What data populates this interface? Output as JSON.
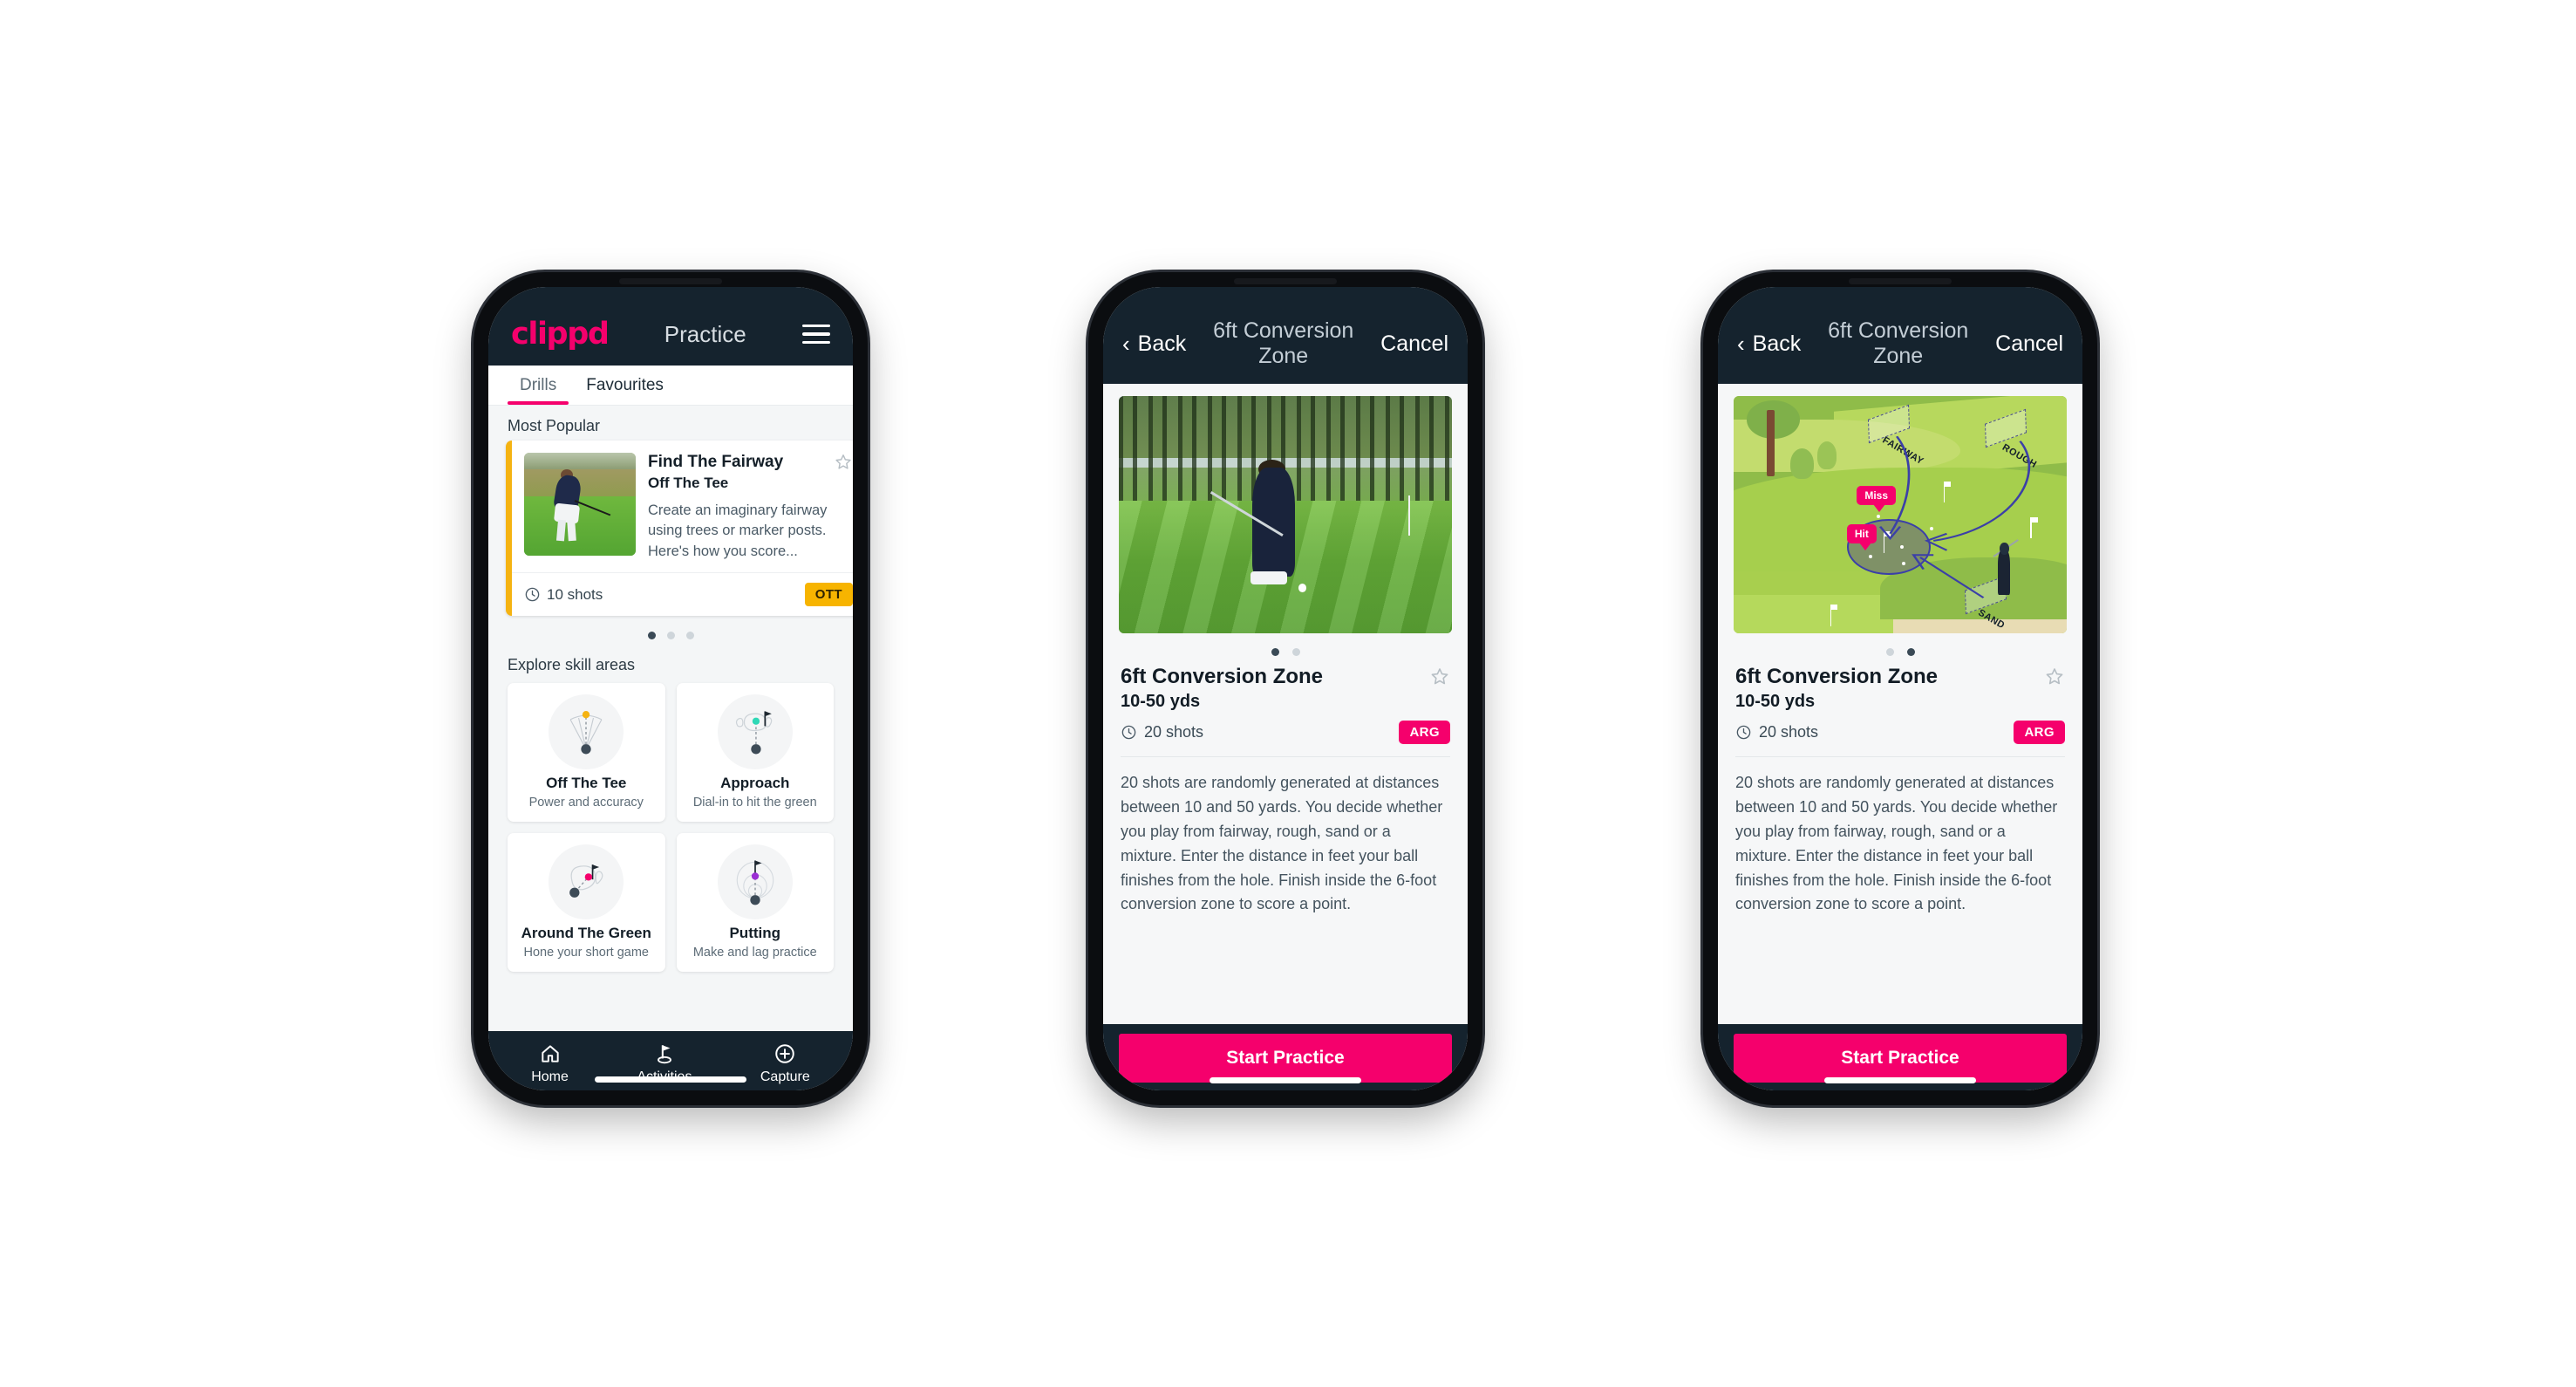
{
  "app": {
    "logo": "clippd",
    "brand_pink": "#f5006c",
    "dark_navy": "#15232e"
  },
  "phone1": {
    "header": {
      "title": "Practice",
      "menu_icon": "hamburger-icon"
    },
    "tabs": [
      {
        "label": "Drills",
        "active": true
      },
      {
        "label": "Favourites",
        "active": false
      }
    ],
    "most_popular": {
      "section_label": "Most Popular",
      "card": {
        "title": "Find The Fairway",
        "subtitle": "Off The Tee",
        "description": "Create an imaginary fairway using trees or marker posts. Here's how you score...",
        "shots": "10 shots",
        "badge": "OTT",
        "badge_color": "#f7b400",
        "accent_color": "#f5b312",
        "star_icon": "star-outline-icon",
        "clock_icon": "clock-icon"
      },
      "peek_accent_color": "#3ddbc0",
      "pagination": {
        "count": 3,
        "active_index": 0
      }
    },
    "explore": {
      "section_label": "Explore skill areas",
      "skills": [
        {
          "name": "Off The Tee",
          "desc": "Power and accuracy",
          "icon": "tee-fan-icon",
          "accent": "#f5b312"
        },
        {
          "name": "Approach",
          "desc": "Dial-in to hit the green",
          "icon": "approach-green-icon",
          "accent": "#3ddbc0"
        },
        {
          "name": "Around The Green",
          "desc": "Hone your short game",
          "icon": "around-green-icon",
          "accent": "#f5006c"
        },
        {
          "name": "Putting",
          "desc": "Make and lag practice",
          "icon": "putting-rings-icon",
          "accent": "#9b2fd4"
        }
      ]
    },
    "bottom_nav": [
      {
        "label": "Home",
        "icon": "home-icon",
        "active": false
      },
      {
        "label": "Activities",
        "icon": "golf-flag-icon",
        "active": true
      },
      {
        "label": "Capture",
        "icon": "plus-circle-icon",
        "active": false
      }
    ]
  },
  "phone2": {
    "header": {
      "back": "Back",
      "title": "6ft Conversion Zone",
      "cancel": "Cancel",
      "back_icon": "chevron-left-icon"
    },
    "hero": {
      "type": "photo",
      "alt": "golfer chipping on fairway"
    },
    "pagination": {
      "count": 2,
      "active_index": 0
    },
    "detail": {
      "name": "6ft Conversion Zone",
      "yards": "10-50 yds",
      "shots": "20 shots",
      "badge": "ARG",
      "badge_color": "#f5006c",
      "star_icon": "star-outline-icon",
      "clock_icon": "clock-icon",
      "description": "20 shots are randomly generated at distances between 10 and 50 yards. You decide whether you play from fairway, rough, sand or a mixture. Enter the distance in feet your ball finishes from the hole. Finish inside the 6-foot conversion zone to score a point."
    },
    "cta": "Start Practice"
  },
  "phone3": {
    "header": {
      "back": "Back",
      "title": "6ft Conversion Zone",
      "cancel": "Cancel",
      "back_icon": "chevron-left-icon"
    },
    "hero": {
      "type": "illustration",
      "labels": [
        "FAIRWAY",
        "ROUGH",
        "SAND"
      ],
      "callouts": [
        "Miss",
        "Hit"
      ],
      "callout_color": "#f5006c"
    },
    "pagination": {
      "count": 2,
      "active_index": 1
    },
    "detail": {
      "name": "6ft Conversion Zone",
      "yards": "10-50 yds",
      "shots": "20 shots",
      "badge": "ARG",
      "badge_color": "#f5006c",
      "star_icon": "star-outline-icon",
      "clock_icon": "clock-icon",
      "description": "20 shots are randomly generated at distances between 10 and 50 yards. You decide whether you play from fairway, rough, sand or a mixture. Enter the distance in feet your ball finishes from the hole. Finish inside the 6-foot conversion zone to score a point."
    },
    "cta": "Start Practice"
  }
}
